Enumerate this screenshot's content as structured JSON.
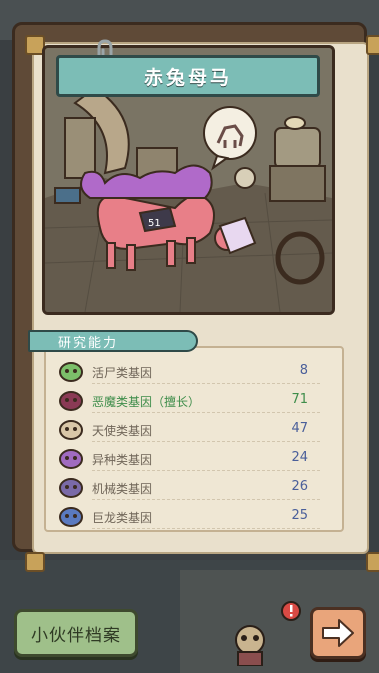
{
  "pet": {
    "name": "赤兔母马"
  },
  "research": {
    "title": "研究能力",
    "genes": [
      {
        "label": "活尸类基因",
        "value": "8",
        "icon": "zombie-gene-icon",
        "special": false
      },
      {
        "label": "恶魔类基因（擅长）",
        "value": "71",
        "icon": "demon-gene-icon",
        "special": true
      },
      {
        "label": "天使类基因",
        "value": "47",
        "icon": "angel-gene-icon",
        "special": false
      },
      {
        "label": "异种类基因",
        "value": "24",
        "icon": "alien-gene-icon",
        "special": false
      },
      {
        "label": "机械类基因",
        "value": "26",
        "icon": "mechanical-gene-icon",
        "special": false
      },
      {
        "label": "巨龙类基因",
        "value": "25",
        "icon": "dragon-gene-icon",
        "special": false
      }
    ]
  },
  "buttons": {
    "archive_label": "小伙伴档案",
    "next_icon": "arrow-right-icon"
  },
  "colors": {
    "teal_plaque": "#7cbdb6",
    "frame_brown": "#5f4a37",
    "parchment": "#e9e0cc",
    "archive_green": "#9fc08a",
    "next_orange": "#e9a57b",
    "value_blue": "#4a5f9a",
    "special_green": "#3e8d4a"
  }
}
